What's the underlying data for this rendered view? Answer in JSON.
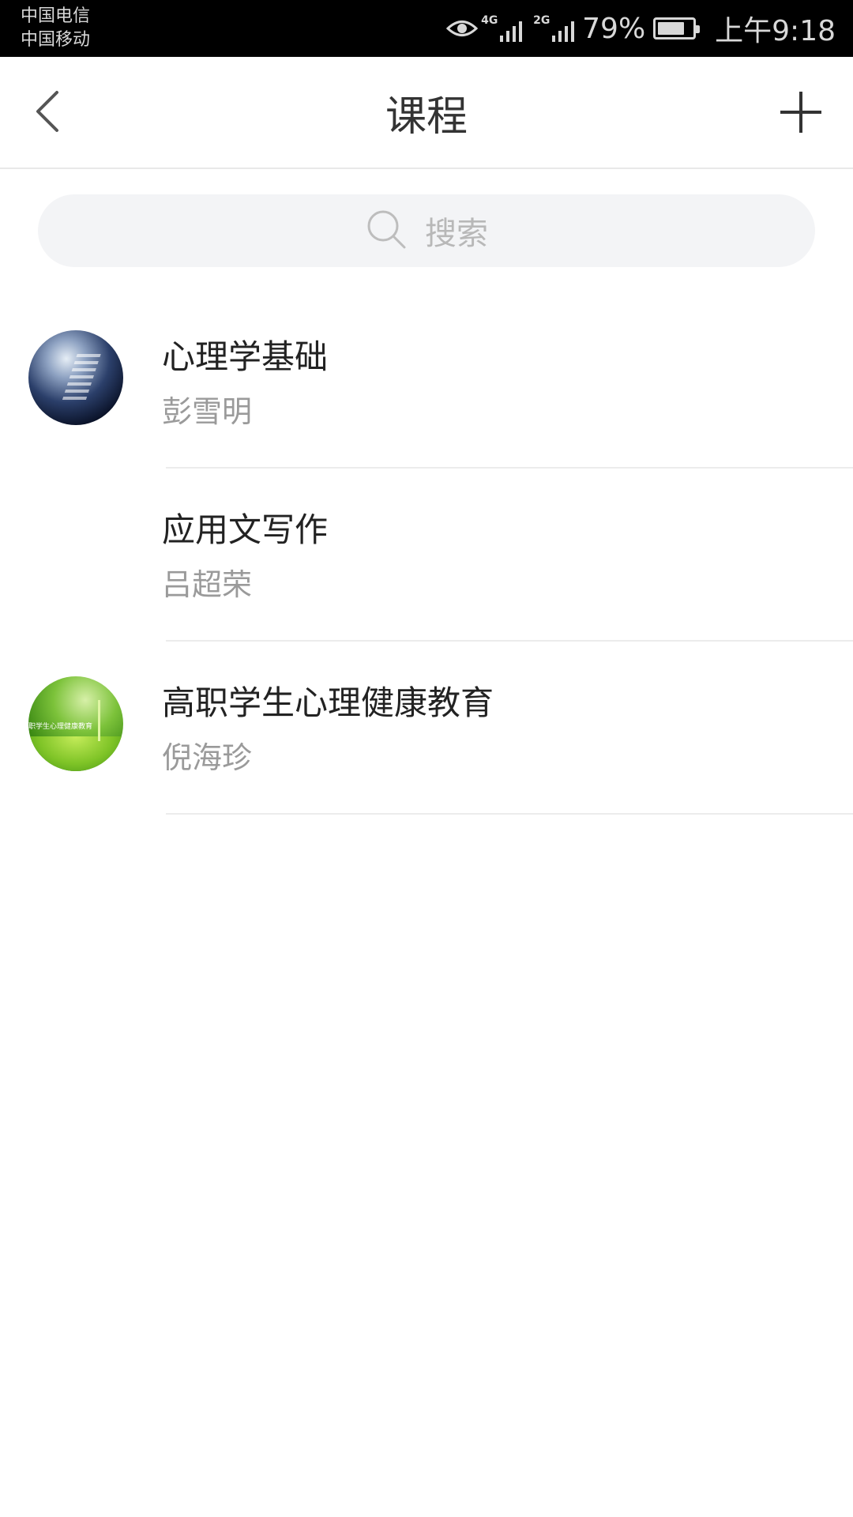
{
  "status_bar": {
    "carrier_1": "中国电信",
    "carrier_2": "中国移动",
    "network_1": "4G",
    "network_2": "2G",
    "battery": "79%",
    "battery_level": 0.79,
    "time": "上午9:18"
  },
  "nav": {
    "title": "课程",
    "back_icon": "chevron-left-icon",
    "add_icon": "plus-icon"
  },
  "search": {
    "placeholder": "搜索",
    "icon": "search-icon"
  },
  "courses": [
    {
      "title": "心理学基础",
      "teacher": "彭雪明",
      "avatar": "psych"
    },
    {
      "title": "应用文写作",
      "teacher": "吕超荣",
      "avatar": "none"
    },
    {
      "title": "高职学生心理健康教育",
      "teacher": "倪海珍",
      "avatar": "health",
      "avatar_caption": "职学生心理健康教育"
    }
  ],
  "colors": {
    "status_bar_bg": "#000000",
    "search_bg": "#f3f4f6",
    "title_text": "#222222",
    "subtitle_text": "#9a9a9a",
    "divider": "#ececec"
  }
}
